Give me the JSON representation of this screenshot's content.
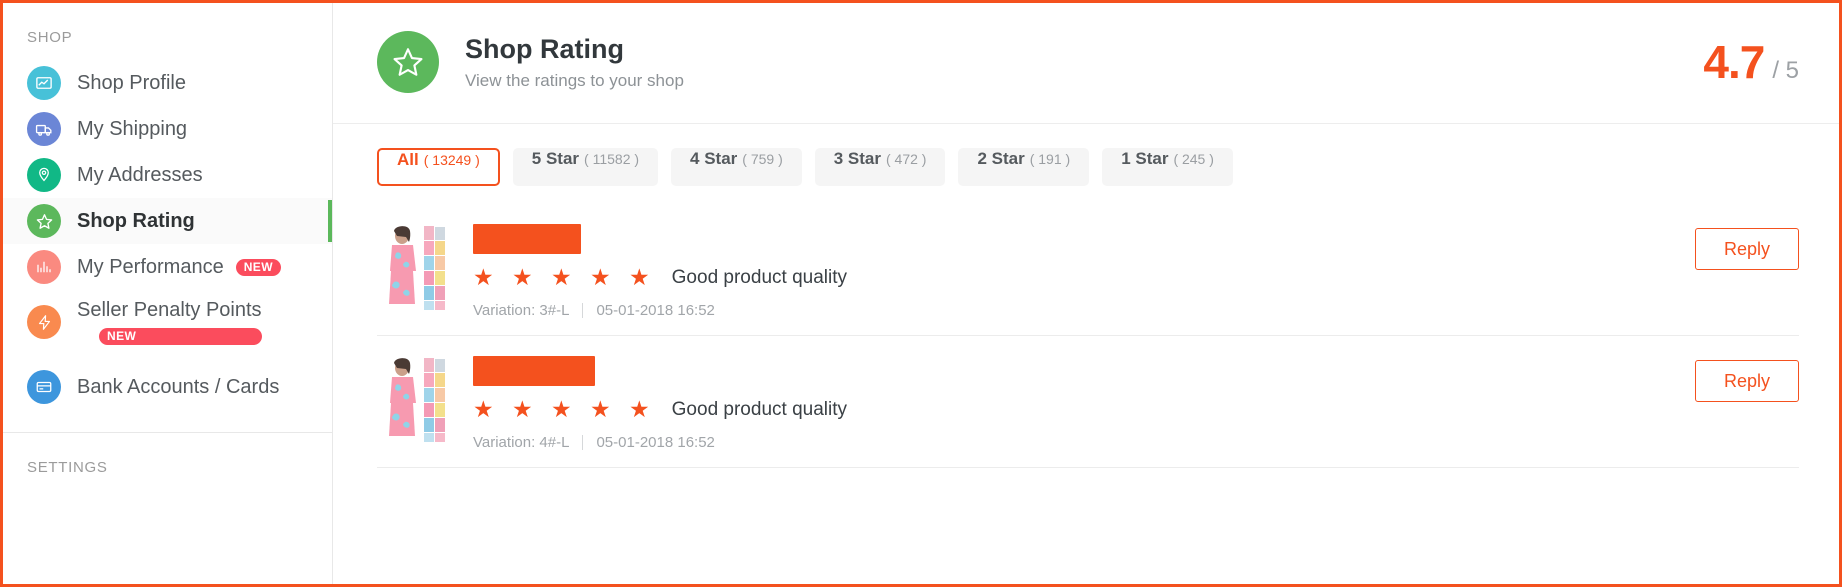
{
  "sidebar": {
    "section_shop_label": "SHOP",
    "section_settings_label": "SETTINGS",
    "items": [
      {
        "label": "Shop Profile",
        "icon": "mail-chart-icon",
        "color": "#47c1d8",
        "badge": "",
        "active": false
      },
      {
        "label": "My Shipping",
        "icon": "truck-icon",
        "color": "#6b86d6",
        "badge": "",
        "active": false
      },
      {
        "label": "My Addresses",
        "icon": "map-pin-icon",
        "color": "#11b886",
        "badge": "",
        "active": false
      },
      {
        "label": "Shop Rating",
        "icon": "star-icon",
        "color": "#5cb85c",
        "badge": "",
        "active": true
      },
      {
        "label": "My Performance",
        "icon": "bar-chart-icon",
        "color": "#fa8a80",
        "badge": "NEW",
        "active": false
      },
      {
        "label": "Seller Penalty Points",
        "icon": "lightning-icon",
        "color": "#f98a4f",
        "badge": "NEW",
        "active": false
      },
      {
        "label": "Bank Accounts / Cards",
        "icon": "credit-card-icon",
        "color": "#3d96dd",
        "badge": "",
        "active": false
      }
    ]
  },
  "header": {
    "icon": "star-outline-icon",
    "title": "Shop Rating",
    "subtitle": "View the ratings to your shop",
    "score_value": "4.7",
    "score_max": "/ 5"
  },
  "filters": [
    {
      "label": "All",
      "count": "( 13249 )",
      "active": true
    },
    {
      "label": "5 Star",
      "count": "( 11582 )",
      "active": false
    },
    {
      "label": "4 Star",
      "count": "( 759 )",
      "active": false
    },
    {
      "label": "3 Star",
      "count": "( 472 )",
      "active": false
    },
    {
      "label": "2 Star",
      "count": "( 191 )",
      "active": false
    },
    {
      "label": "1 Star",
      "count": "( 245 )",
      "active": false
    }
  ],
  "reviews": [
    {
      "stars": "★ ★ ★ ★ ★",
      "comment": "Good product quality",
      "variation": "Variation: 3#-L",
      "timestamp": "05-01-2018 16:52",
      "reply_label": "Reply"
    },
    {
      "stars": "★ ★ ★ ★ ★",
      "comment": "Good product quality",
      "variation": "Variation: 4#-L",
      "timestamp": "05-01-2018 16:52",
      "reply_label": "Reply"
    }
  ],
  "colors": {
    "accent_orange": "#f4511e",
    "active_green": "#5cb85c",
    "badge_red": "#fb4c5d"
  }
}
